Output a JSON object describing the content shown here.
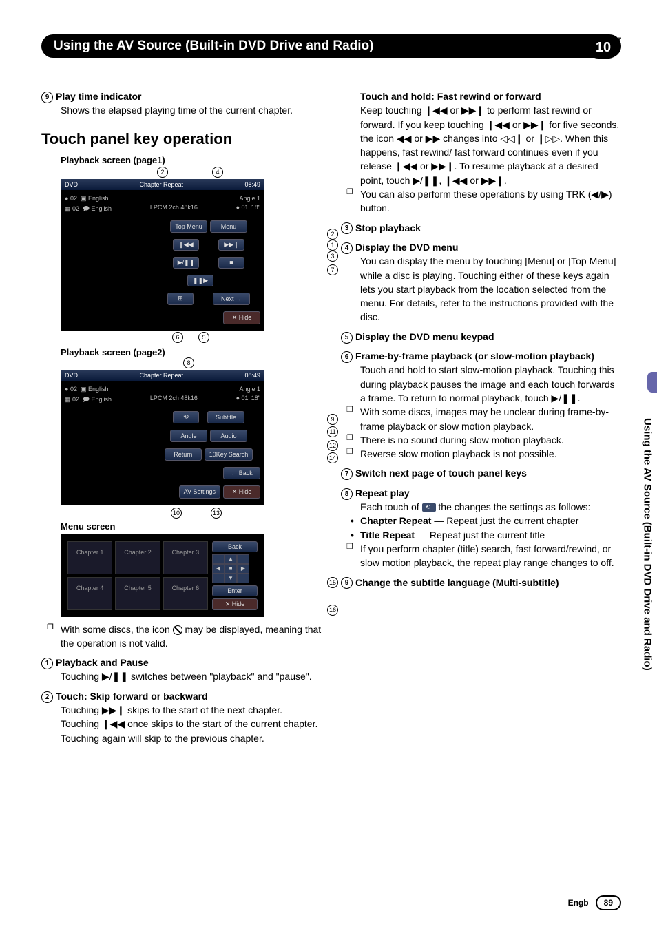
{
  "header": {
    "chapter_label": "Chapter",
    "chapter_num": "10",
    "title": "Using the AV Source (Built-in DVD Drive and Radio)"
  },
  "side_tab": "Using the AV Source (Built-in DVD Drive and Radio)",
  "left": {
    "item9_head": "Play time indicator",
    "item9_body": "Shows the elapsed playing time of the current chapter.",
    "section_title": "Touch panel key operation",
    "label_page1": "Playback screen (page1)",
    "label_page2": "Playback screen (page2)",
    "label_menu": "Menu screen",
    "note_body": "With some discs, the icon ",
    "note_body2": " may be displayed, meaning that the operation is not valid.",
    "item1_head": "Playback and Pause",
    "item1_body": "Touching ▶/❚❚ switches between \"playback\" and \"pause\".",
    "item2_head": "Touch: Skip forward or backward",
    "item2_body": "Touching ▶▶❙ skips to the start of the next chapter. Touching ❙◀◀ once skips to the start of the current chapter. Touching again will skip to the previous chapter."
  },
  "scr1": {
    "src": "DVD",
    "track": "02",
    "title": "02",
    "lang1": "English",
    "lang2": "English",
    "angle": "Angle 1",
    "codec": "LPCM 2ch 48k16",
    "chapter": "Chapter",
    "repeat": "Repeat",
    "time": "08:49",
    "elapsed": "01' 18\"",
    "top_menu": "Top Menu",
    "menu": "Menu",
    "prev": "❙◀◀",
    "next_trk": "▶▶❙",
    "play": "▶/❚❚",
    "stop": "■",
    "slow": "❚❚▶",
    "keypad_icon": "⊞",
    "next": "Next →",
    "hide": "✕ Hide"
  },
  "scr2": {
    "subtitle": "Subtitle",
    "angle": "Angle",
    "audio": "Audio",
    "return": "Return",
    "tenkey": "10Key Search",
    "back": "← Back",
    "avsettings": "AV Settings",
    "hide": "✕ Hide",
    "repeat_btn": "⟲"
  },
  "menu": {
    "c1": "Chapter 1",
    "c2": "Chapter 2",
    "c3": "Chapter 3",
    "c4": "Chapter 4",
    "c5": "Chapter 5",
    "c6": "Chapter 6",
    "back": "Back",
    "enter": "Enter",
    "hide": "✕ Hide"
  },
  "right": {
    "hold_head": "Touch and hold: Fast rewind or forward",
    "hold_body": "Keep touching ❙◀◀ or ▶▶❙ to perform fast rewind or forward. If you keep touching ❙◀◀ or ▶▶❙ for five seconds, the icon ◀◀ or ▶▶ changes into ◁◁❙ or ❙▷▷. When this happens, fast rewind/ fast forward continues even if you release ❙◀◀ or ▶▶❙. To resume playback at a desired point, touch ▶/❚❚, ❙◀◀ or ▶▶❙.",
    "hold_sub": "You can also perform these operations by using TRK (◀/▶) button.",
    "item3_head": "Stop playback",
    "item4_head": "Display the DVD menu",
    "item4_body": "You can display the menu by touching [Menu] or [Top Menu] while a disc is playing. Touching either of these keys again lets you start playback from the location selected from the menu. For details, refer to the instructions provided with the disc.",
    "item5_head": "Display the DVD menu keypad",
    "item6_head": "Frame-by-frame playback (or slow-motion playback)",
    "item6_body": "Touch and hold to start slow-motion playback. Touching this during playback pauses the image and each touch forwards a frame. To return to normal playback, touch ▶/❚❚.",
    "item6_sub1": "With some discs, images may be unclear during frame-by-frame playback or slow motion playback.",
    "item6_sub2": "There is no sound during slow motion playback.",
    "item6_sub3": "Reverse slow motion playback is not possible.",
    "item7_head": "Switch next page of touch panel keys",
    "item8_head": "Repeat play",
    "item8_body": "Each touch of ",
    "item8_body2": " the changes the settings as follows:",
    "item8_b1h": "Chapter Repeat",
    "item8_b1": " — Repeat just the current chapter",
    "item8_b2h": "Title Repeat",
    "item8_b2": " — Repeat just the current title",
    "item8_sub": "If you perform chapter (title) search, fast forward/rewind, or slow motion playback, the repeat play range changes to off.",
    "item9_head": "Change the subtitle language (Multi-subtitle)"
  },
  "footer": {
    "lang": "Engb",
    "page": "89"
  }
}
